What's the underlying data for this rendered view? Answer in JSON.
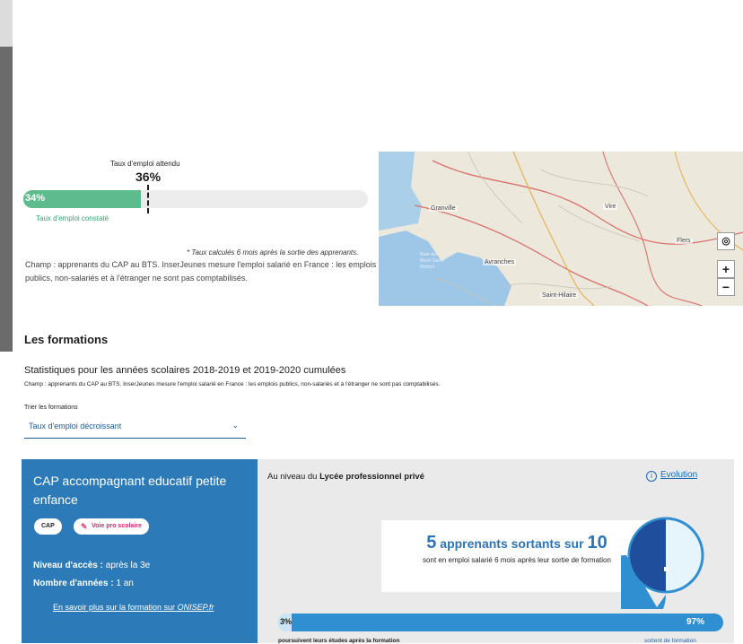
{
  "employment_rate": {
    "expected_label": "Taux d'emploi attendu",
    "expected_value": "36%",
    "expected_fraction": 0.36,
    "observed_value": "34%",
    "observed_fraction": 0.34,
    "observed_label": "Taux d'emploi constaté",
    "footnote": "* Taux calculés 6 mois après la sortie des apprenants.",
    "scope": "Champ : apprenants du CAP au BTS. InserJeunes mesure l'emploi salarié en France : les emplois publics, non-salariés et à l'étranger ne sont pas comptabilisés.",
    "colors": {
      "fill": "#5ebb8e",
      "track": "#ececec"
    }
  },
  "map": {
    "cities": [
      "Granville",
      "Vire",
      "Flers",
      "Avranches",
      "Saint-Hilaire"
    ],
    "bay_label": "Baie du Mont Saint-Michel",
    "locate_icon": "locate-target-icon",
    "zoom_in_label": "+",
    "zoom_out_label": "−"
  },
  "formations": {
    "section_title": "Les formations",
    "stats_title": "Statistiques pour les années scolaires 2018-2019 et 2019-2020 cumulées",
    "stats_scope": "Champ : apprenants du CAP au BTS. InserJeunes mesure l'emploi salarié en France : les emplois publics, non-salariés et à l'étranger ne sont pas comptabilisés.",
    "sort_label": "Trier les formations",
    "sort_value": "Taux d'emploi décroissant"
  },
  "card": {
    "title": "CAP accompagnant educatif petite enfance",
    "tag_level": "CAP",
    "tag_track": "Voie pro scolaire",
    "access_label": "Niveau d'accès :",
    "access_value": "après la 3e",
    "years_label": "Nombre d'années :",
    "years_value": "1 an",
    "onisep_prefix": "En savoir plus sur la formation sur ",
    "onisep_site": "ONISEP.fr",
    "color": "#2c7bb8"
  },
  "level_panel": {
    "prefix": "Au niveau du",
    "establishment": "Lycée professionnel privé",
    "evolution_label": "Evolution",
    "result_count": "5",
    "result_mid": "apprenants sortants sur",
    "result_total": "10",
    "result_sub": "sont en emploi salarié 6 mois après leur sortie de formation",
    "gauge_fraction": 0.5,
    "continuing_value": "3%",
    "continuing_fraction": 0.03,
    "leaving_value": "97%",
    "continuing_caption": "poursuivent leurs études après la formation",
    "leaving_caption": "sortent de formation",
    "colors": {
      "gauge_dark": "#1f4f9c",
      "gauge_light": "#e6f4fb",
      "gauge_ring": "#2f8fd0",
      "split": "#2f8fd0"
    }
  }
}
